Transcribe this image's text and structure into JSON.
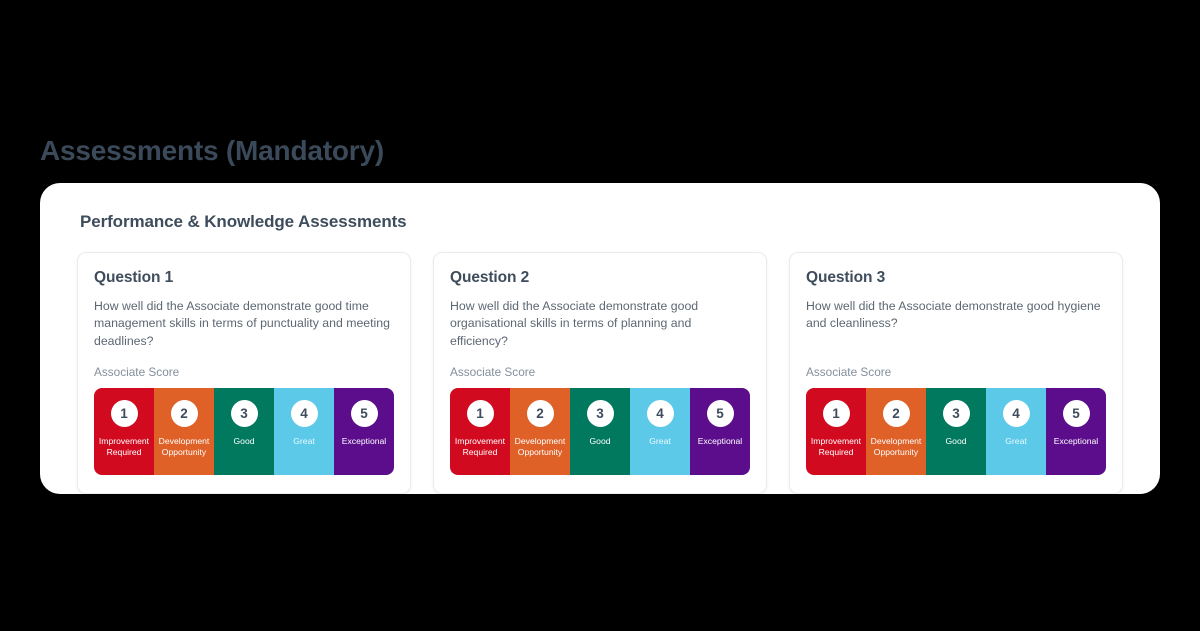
{
  "page": {
    "title": "Assessments (Mandatory)",
    "background_color": "#000000",
    "title_color": "#3b4a5a"
  },
  "panel": {
    "title": "Performance & Knowledge Assessments",
    "background_color": "#ffffff"
  },
  "score_scale": {
    "label": "Associate Score",
    "segments": [
      {
        "number": "1",
        "label": "Improvement Required",
        "color": "#d10a1f",
        "text_color": "#ffffff"
      },
      {
        "number": "2",
        "label": "Development Opportunity",
        "color": "#df6128",
        "text_color": "#ffffff"
      },
      {
        "number": "3",
        "label": "Good",
        "color": "#00795f",
        "text_color": "#ffffff"
      },
      {
        "number": "4",
        "label": "Great",
        "color": "#5cc9e9",
        "text_color": "#eafaff"
      },
      {
        "number": "5",
        "label": "Exceptional",
        "color": "#5b0d8c",
        "text_color": "#ffffff"
      }
    ]
  },
  "questions": [
    {
      "title": "Question 1",
      "text": "How well did the Associate demonstrate good time management skills in terms of punctuality and meeting deadlines?",
      "score_label": "Associate Score"
    },
    {
      "title": "Question 2",
      "text": "How well did the Associate demonstrate good organisational skills in terms of planning and efficiency?",
      "score_label": "Associate Score"
    },
    {
      "title": "Question 3",
      "text": "How well did the Associate demonstrate good hygiene and cleanliness?",
      "score_label": "Associate Score"
    }
  ]
}
